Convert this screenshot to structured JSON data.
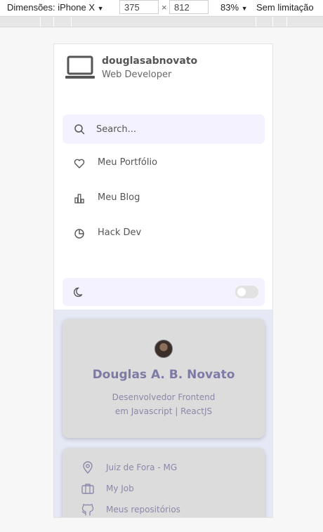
{
  "devtools": {
    "device_label": "Dimensões: iPhone X",
    "width_value": "375",
    "times": "×",
    "height_value": "812",
    "zoom": "83%",
    "throttle": "Sem limitação"
  },
  "profile": {
    "username": "douglasabnovato",
    "role": "Web Developer"
  },
  "search": {
    "placeholder": "Search..."
  },
  "nav": [
    {
      "label": "Meu Portfólio",
      "icon": "heart-icon"
    },
    {
      "label": "Meu Blog",
      "icon": "bar-chart-icon"
    },
    {
      "label": "Hack Dev",
      "icon": "pie-chart-icon"
    }
  ],
  "theme": {
    "icon": "moon-icon",
    "dark_mode": false
  },
  "card": {
    "name": "Douglas A. B. Novato",
    "desc_line1": "Desenvolvedor Frontend",
    "desc_line2": "em Javascript | ReactJS"
  },
  "info": [
    {
      "label": "Juiz de Fora - MG",
      "icon": "map-pin-icon"
    },
    {
      "label": "My Job",
      "icon": "briefcase-icon"
    },
    {
      "label": "Meus repositórios",
      "icon": "github-icon"
    }
  ],
  "colors": {
    "accent_bg": "#f3f2fe",
    "card_bg": "#dcdcdc",
    "title_color": "#7d7ba6",
    "content_bg": "#e5e8f5"
  }
}
